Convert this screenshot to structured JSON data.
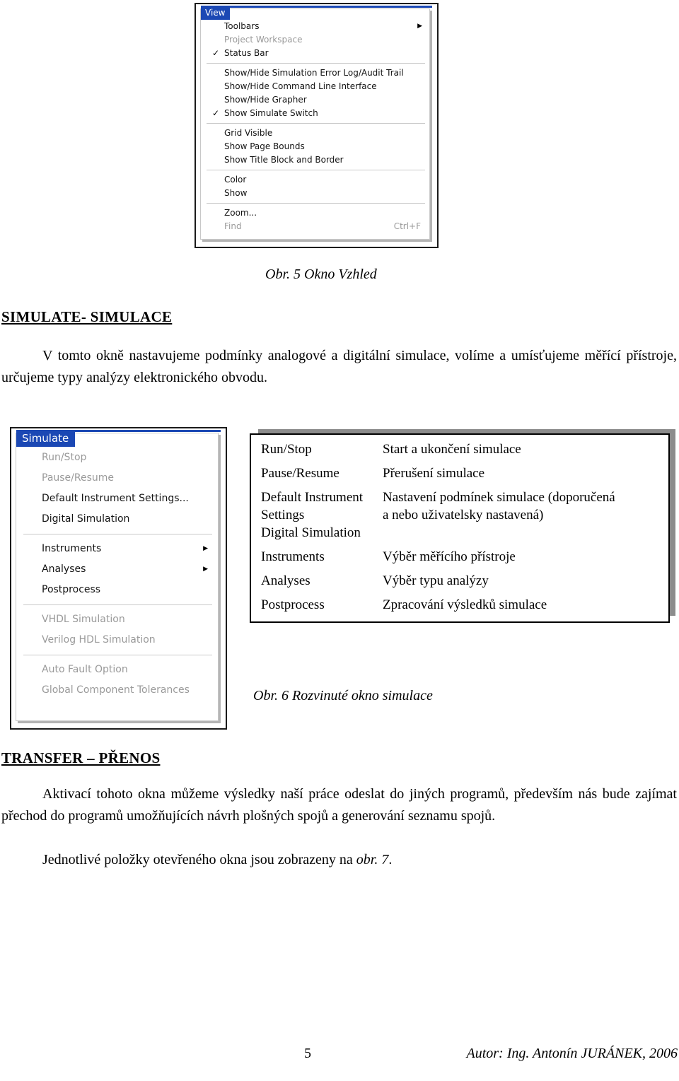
{
  "view_menu": {
    "title": "View",
    "groups": [
      [
        {
          "label": "Toolbars",
          "disabled": false,
          "checked": false,
          "submenu": true,
          "shortcut": ""
        },
        {
          "label": "Project Workspace",
          "disabled": true,
          "checked": false,
          "submenu": false,
          "shortcut": ""
        },
        {
          "label": "Status Bar",
          "disabled": false,
          "checked": true,
          "submenu": false,
          "shortcut": ""
        }
      ],
      [
        {
          "label": "Show/Hide Simulation Error Log/Audit Trail",
          "disabled": false,
          "checked": false,
          "submenu": false,
          "shortcut": ""
        },
        {
          "label": "Show/Hide Command Line Interface",
          "disabled": false,
          "checked": false,
          "submenu": false,
          "shortcut": ""
        },
        {
          "label": "Show/Hide Grapher",
          "disabled": false,
          "checked": false,
          "submenu": false,
          "shortcut": ""
        },
        {
          "label": "Show Simulate Switch",
          "disabled": false,
          "checked": true,
          "submenu": false,
          "shortcut": ""
        }
      ],
      [
        {
          "label": "Grid Visible",
          "disabled": false,
          "checked": false,
          "submenu": false,
          "shortcut": ""
        },
        {
          "label": "Show Page Bounds",
          "disabled": false,
          "checked": false,
          "submenu": false,
          "shortcut": ""
        },
        {
          "label": "Show Title Block and Border",
          "disabled": false,
          "checked": false,
          "submenu": false,
          "shortcut": ""
        }
      ],
      [
        {
          "label": "Color",
          "disabled": false,
          "checked": false,
          "submenu": false,
          "shortcut": ""
        },
        {
          "label": "Show",
          "disabled": false,
          "checked": false,
          "submenu": false,
          "shortcut": ""
        }
      ],
      [
        {
          "label": "Zoom...",
          "disabled": false,
          "checked": false,
          "submenu": false,
          "shortcut": ""
        },
        {
          "label": "Find",
          "disabled": true,
          "checked": false,
          "submenu": false,
          "shortcut": "Ctrl+F"
        }
      ]
    ]
  },
  "simulate_menu": {
    "title": "Simulate",
    "groups": [
      [
        {
          "label": "Run/Stop",
          "disabled": true,
          "submenu": false
        },
        {
          "label": "Pause/Resume",
          "disabled": true,
          "submenu": false
        },
        {
          "label": "Default Instrument Settings...",
          "disabled": false,
          "submenu": false
        },
        {
          "label": "Digital Simulation",
          "disabled": false,
          "submenu": false
        }
      ],
      [
        {
          "label": "Instruments",
          "disabled": false,
          "submenu": true
        },
        {
          "label": "Analyses",
          "disabled": false,
          "submenu": true
        },
        {
          "label": "Postprocess",
          "disabled": false,
          "submenu": false
        }
      ],
      [
        {
          "label": "VHDL Simulation",
          "disabled": true,
          "submenu": false
        },
        {
          "label": "Verilog HDL Simulation",
          "disabled": true,
          "submenu": false
        }
      ],
      [
        {
          "label": "Auto Fault Option",
          "disabled": true,
          "submenu": false
        },
        {
          "label": "Global Component Tolerances",
          "disabled": true,
          "submenu": false
        }
      ]
    ]
  },
  "explanation_table": {
    "rows": [
      {
        "term": "Run/Stop",
        "description": "Start a ukončení simulace"
      },
      {
        "term": "Pause/Resume",
        "description": "Přerušení simulace"
      },
      {
        "term": "Default Instrument\nSettings\nDigital Simulation",
        "description": "Nastavení podmínek simulace (doporučená\na nebo uživatelsky nastavená)"
      },
      {
        "term": "Instruments",
        "description": "Výběr měřícího přístroje"
      },
      {
        "term": "Analyses",
        "description": "Výběr typu analýzy"
      },
      {
        "term": "Postprocess",
        "description": "Zpracování výsledků simulace"
      }
    ]
  },
  "captions": {
    "fig5": "Obr. 5 Okno Vzhled",
    "fig6": "Obr. 6 Rozvinuté okno simulace"
  },
  "headings": {
    "simulate": "SIMULATE- SIMULACE",
    "transfer": "TRANSFER – PŘENOS"
  },
  "paragraphs": {
    "simulate": "V tomto okně nastavujeme podmínky analogové a digitální simulace, volíme a umísťujeme měřící přístroje, určujeme typy analýzy elektronického obvodu.",
    "transfer": "Aktivací tohoto okna můžeme výsledky naší práce odeslat do jiných programů, především nás bude zajímat přechod do programů umožňujících návrh plošných spojů a generování seznamu spojů.",
    "transfer2_before": "Jednotlivé položky otevřeného okna jsou zobrazeny na ",
    "transfer2_italic": "obr. 7",
    "transfer2_after": "."
  },
  "footer": {
    "page_number": "5",
    "author": "Autor: Ing. Antonín JURÁNEK, 2006"
  },
  "colors": {
    "menu_title_bg": "#1b48b4",
    "menu_text": "#141414",
    "menu_disabled": "#9a9a9a",
    "separator": "#c9c9c9",
    "shadow": "#8c8c8c"
  }
}
